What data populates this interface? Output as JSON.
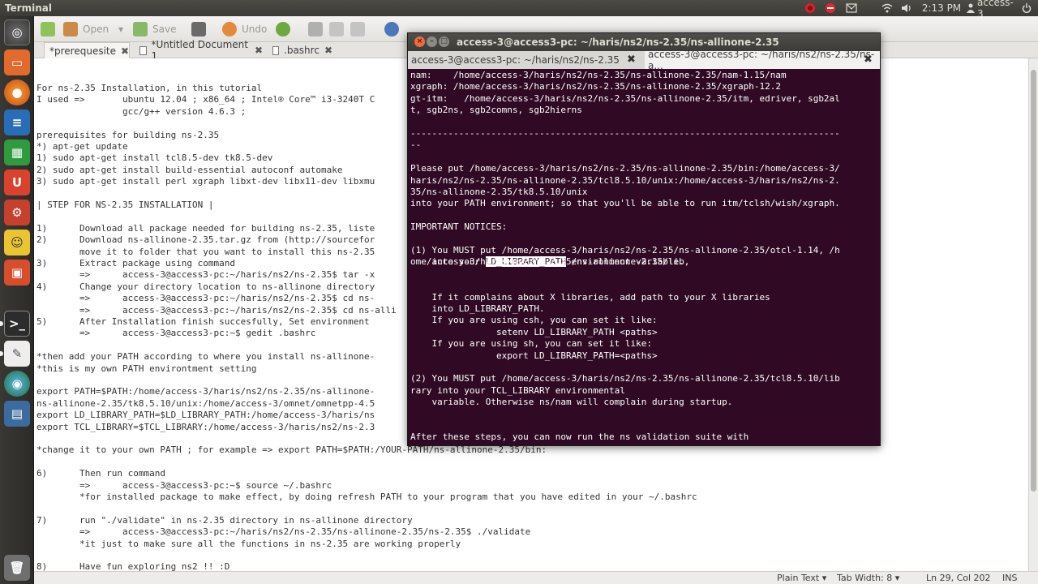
{
  "panel": {
    "app_title": "Terminal",
    "clock": "2:13 PM",
    "user": "access-3",
    "volume_icon": "speaker-icon",
    "wifi_icon": "wifi-icon",
    "mail_icon": "mail-icon"
  },
  "launcher": {
    "items": [
      "dash-icon",
      "files-icon",
      "firefox-icon",
      "writer-icon",
      "calc-icon",
      "ubuntu-software-icon",
      "settings-icon",
      "gnome-game-icon",
      "backup-icon",
      "terminal-icon",
      "gedit-icon",
      "browser-icon",
      "workspace-icon",
      "trash-icon"
    ]
  },
  "toolbar": {
    "open": "Open",
    "save": "Save",
    "undo": "Undo"
  },
  "editor_tabs": [
    {
      "label": "*prerequesite"
    },
    {
      "label": "*Untitled Document 1"
    },
    {
      "label": ".bashrc"
    }
  ],
  "editor": {
    "lines": [
      "For ns-2.35 Installation, in this tutorial",
      "I used =>       ubuntu 12.04 ; x86_64 ; Intel® Core™ i3-3240T C",
      "                gcc/g++ version 4.6.3 ;",
      "",
      "prerequisites for building ns-2.35",
      "*) apt-get update",
      "1) sudo apt-get install tcl8.5-dev tk8.5-dev",
      "2) sudo apt-get install build-essential autoconf automake",
      "3) sudo apt-get install perl xgraph libxt-dev libx11-dev libxmu",
      "",
      "| STEP FOR NS-2.35 INSTALLATION |",
      "",
      "1)      Download all package needed for building ns-2.35, liste",
      "2)      Download ns-allinone-2.35.tar.gz from (http://sourcefor",
      "        move it to folder that you want to install this ns-2.35",
      "3)      Extract package using command",
      "        =>      access-3@access3-pc:~/haris/ns2/ns-2.35$ tar -x",
      "4)      Change your directory location to ns-allinone directory",
      "        =>      access-3@access3-pc:~/haris/ns2/ns-2.35$ cd ns-",
      "        =>      access-3@access3-pc:~/haris/ns2/ns-2.35$ cd ns-alli",
      "5)      After Installation finish succesfully, Set environment",
      "        =>      access-3@access3-pc:~$ gedit .bashrc",
      "",
      "*then add your PATH according to where you install ns-allinone-",
      "*this is my own PATH environtment setting",
      "",
      "export PATH=$PATH:/home/access-3/haris/ns2/ns-2.35/ns-allinone-                                                     cess-3/haris/ns2/ns-2.35/",
      "ns-allinone-2.35/tk8.5.10/unix:/home/access-3/omnet/omnetpp-4.5",
      "export LD_LIBRARY_PATH=$LD_LIBRARY_PATH:/home/access-3/haris/ns                                                      2.35/lib",
      "export TCL_LIBRARY=$TCL_LIBRARY:/home/access-3/haris/ns2/ns-2.3",
      "",
      "*change it to your own PATH ; for example => export PATH=$PATH:/YOUR-PATH/ns-allinone-2.35/bin:",
      "",
      "6)      Then run command",
      "        =>      access-3@access3-pc:~$ source ~/.bashrc",
      "        *for installed package to make effect, by doing refresh PATH to your program that you have edited in your ~/.bashrc",
      "",
      "7)      run \"./validate\" in ns-2.35 directory in ns-allinone directory",
      "        =>      access-3@access3-pc:~/haris/ns2/ns-2.35/ns-allinone-2.35/ns-2.35$ ./validate",
      "        *it just to make sure all the functions in ns-2.35 are working properly",
      "",
      "8)      Have fun exploring ns2 !! :D"
    ]
  },
  "statusbar": {
    "language": "Plain Text ▾",
    "tab_width": "Tab Width: 8 ▾",
    "position": "Ln 29, Col 202",
    "mode": "INS"
  },
  "terminal": {
    "title": "access-3@access3-pc: ~/haris/ns2/ns-2.35/ns-allinone-2.35",
    "tabs": [
      {
        "label": "access-3@access3-pc: ~/haris/ns2/ns-2.35"
      },
      {
        "label": "access-3@access3-pc: ~/haris/ns2/ns-2.35/ns-a..."
      }
    ],
    "lines": [
      "nam:    /home/access-3/haris/ns2/ns-2.35/ns-allinone-2.35/nam-1.15/nam",
      "xgraph: /home/access-3/haris/ns2/ns-2.35/ns-allinone-2.35/xgraph-12.2",
      "gt-itm:   /home/access-3/haris/ns2/ns-2.35/ns-allinone-2.35/itm, edriver, sgb2al",
      "t, sgb2ns, sgb2comns, sgb2hierns",
      "",
      "--------------------------------------------------------------------------------",
      "--",
      "",
      "Please put /home/access-3/haris/ns2/ns-2.35/ns-allinone-2.35/bin:/home/access-3/",
      "haris/ns2/ns-2.35/ns-allinone-2.35/tcl8.5.10/unix:/home/access-3/haris/ns2/ns-2.",
      "35/ns-allinone-2.35/tk8.5.10/unix",
      "into your PATH environment; so that you'll be able to run itm/tclsh/wish/xgraph.",
      "",
      "IMPORTANT NOTICES:",
      "",
      "(1) You MUST put /home/access-3/haris/ns2/ns-2.35/ns-allinone-2.35/otcl-1.14, /h",
      "ome/access-3/haris/ns2/ns-2.35/ns-allinone-2.35/lib,",
      "",
      "    If it complains about X libraries, add path to your X libraries",
      "    into LD_LIBRARY_PATH.",
      "    If you are using csh, you can set it like:",
      "                setenv LD_LIBRARY_PATH <paths>",
      "    If you are using sh, you can set it like:",
      "                export LD_LIBRARY_PATH=<paths>",
      "",
      "(2) You MUST put /home/access-3/haris/ns2/ns-2.35/ns-allinone-2.35/tcl8.5.10/lib",
      "rary into your TCL_LIBRARY environmental",
      "    variable. Otherwise ns/nam will complain during startup.",
      "",
      "",
      "After these steps, you can now run the ns validation suite with",
      "cd ns-2.35; ./validate"
    ],
    "line17_pre": "    into your ",
    "line17_hl": "LD_LIBRARY_PATH",
    "line17_post": " environment variable."
  }
}
